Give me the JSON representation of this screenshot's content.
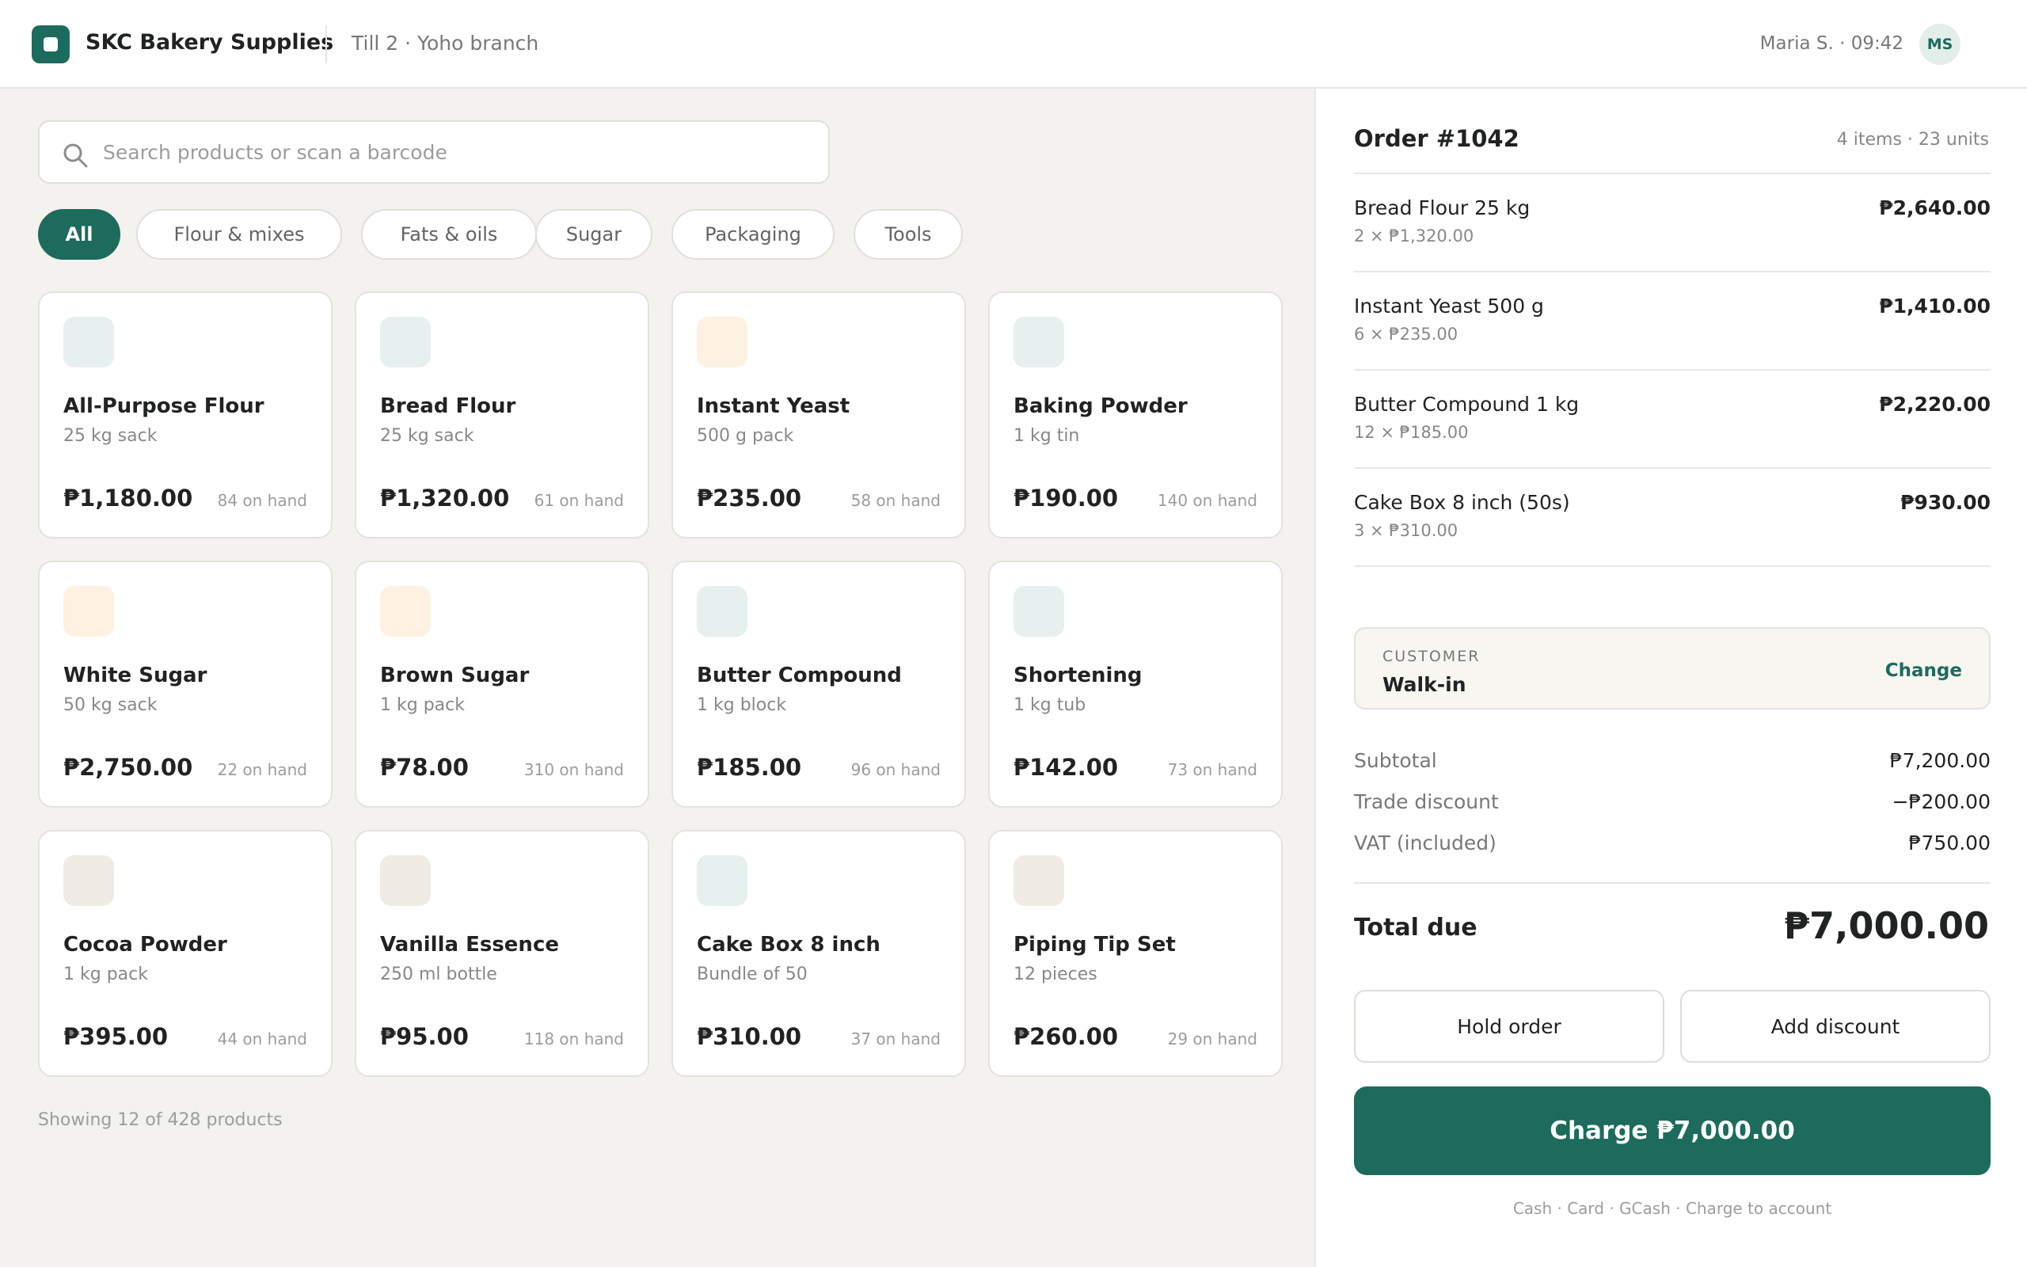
{
  "header": {
    "brand": "SKC Bakery Supplies",
    "till": "Till 2 · Yoho branch",
    "user": "Maria S. · 09:42",
    "avatar_initials": "MS"
  },
  "search": {
    "placeholder": "Search products or scan a barcode",
    "value": ""
  },
  "categories": [
    {
      "label": "All",
      "active": true
    },
    {
      "label": "Flour & mixes",
      "active": false
    },
    {
      "label": "Fats & oils",
      "active": false
    },
    {
      "label": "Sugar",
      "active": false
    },
    {
      "label": "Packaging",
      "active": false
    },
    {
      "label": "Tools",
      "active": false
    }
  ],
  "products": [
    {
      "name": "All-Purpose Flour",
      "unit": "25 kg sack",
      "price": "₱1,180.00",
      "stock": "84 on hand",
      "swatch": "#e6f0ee"
    },
    {
      "name": "Bread Flour",
      "unit": "25 kg sack",
      "price": "₱1,320.00",
      "stock": "61 on hand",
      "swatch": "#e6f0ee"
    },
    {
      "name": "Instant Yeast",
      "unit": "500 g pack",
      "price": "₱235.00",
      "stock": "58 on hand",
      "swatch": "#fdf1e2"
    },
    {
      "name": "Baking Powder",
      "unit": "1 kg tin",
      "price": "₱190.00",
      "stock": "140 on hand",
      "swatch": "#e6f0ee"
    },
    {
      "name": "White Sugar",
      "unit": "50 kg sack",
      "price": "₱2,750.00",
      "stock": "22 on hand",
      "swatch": "#fdf1e2"
    },
    {
      "name": "Brown Sugar",
      "unit": "1 kg pack",
      "price": "₱78.00",
      "stock": "310 on hand",
      "swatch": "#fdf1e2"
    },
    {
      "name": "Butter Compound",
      "unit": "1 kg block",
      "price": "₱185.00",
      "stock": "96 on hand",
      "swatch": "#e6f0ee"
    },
    {
      "name": "Shortening",
      "unit": "1 kg tub",
      "price": "₱142.00",
      "stock": "73 on hand",
      "swatch": "#e6f0ee"
    },
    {
      "name": "Cocoa Powder",
      "unit": "1 kg pack",
      "price": "₱395.00",
      "stock": "44 on hand",
      "swatch": "#f0ebe3"
    },
    {
      "name": "Vanilla Essence",
      "unit": "250 ml bottle",
      "price": "₱95.00",
      "stock": "118 on hand",
      "swatch": "#f0ebe3"
    },
    {
      "name": "Cake Box 8 inch",
      "unit": "Bundle of 50",
      "price": "₱310.00",
      "stock": "37 on hand",
      "swatch": "#e6f0ee"
    },
    {
      "name": "Piping Tip Set",
      "unit": "12 pieces",
      "price": "₱260.00",
      "stock": "29 on hand",
      "swatch": "#f0ebe3"
    }
  ],
  "showing_text": "Showing 12 of 428 products",
  "order": {
    "title": "Order #1042",
    "meta": "4 items · 23 units",
    "lines": [
      {
        "name": "Bread Flour 25 kg",
        "qty": "2 × ₱1,320.00",
        "total": "₱2,640.00"
      },
      {
        "name": "Instant Yeast 500 g",
        "qty": "6 × ₱235.00",
        "total": "₱1,410.00"
      },
      {
        "name": "Butter Compound 1 kg",
        "qty": "12 × ₱185.00",
        "total": "₱2,220.00"
      },
      {
        "name": "Cake Box 8 inch (50s)",
        "qty": "3 × ₱310.00",
        "total": "₱930.00"
      }
    ],
    "customer": {
      "label": "CUSTOMER",
      "value": "Walk-in",
      "change_label": "Change"
    },
    "summary": [
      {
        "label": "Subtotal",
        "value": "₱7,200.00"
      },
      {
        "label": "Trade discount",
        "value": "−₱200.00"
      },
      {
        "label": "VAT (included)",
        "value": "₱750.00"
      }
    ],
    "total_label": "Total due",
    "total_value": "₱7,000.00",
    "hold_label": "Hold order",
    "discount_label": "Add discount",
    "charge_label": "Charge ₱7,000.00",
    "payment_methods": "Cash · Card · GCash · Charge to account"
  },
  "colors": {
    "accent": "#1c6b5c",
    "panel_bg": "#f3f2ee"
  }
}
